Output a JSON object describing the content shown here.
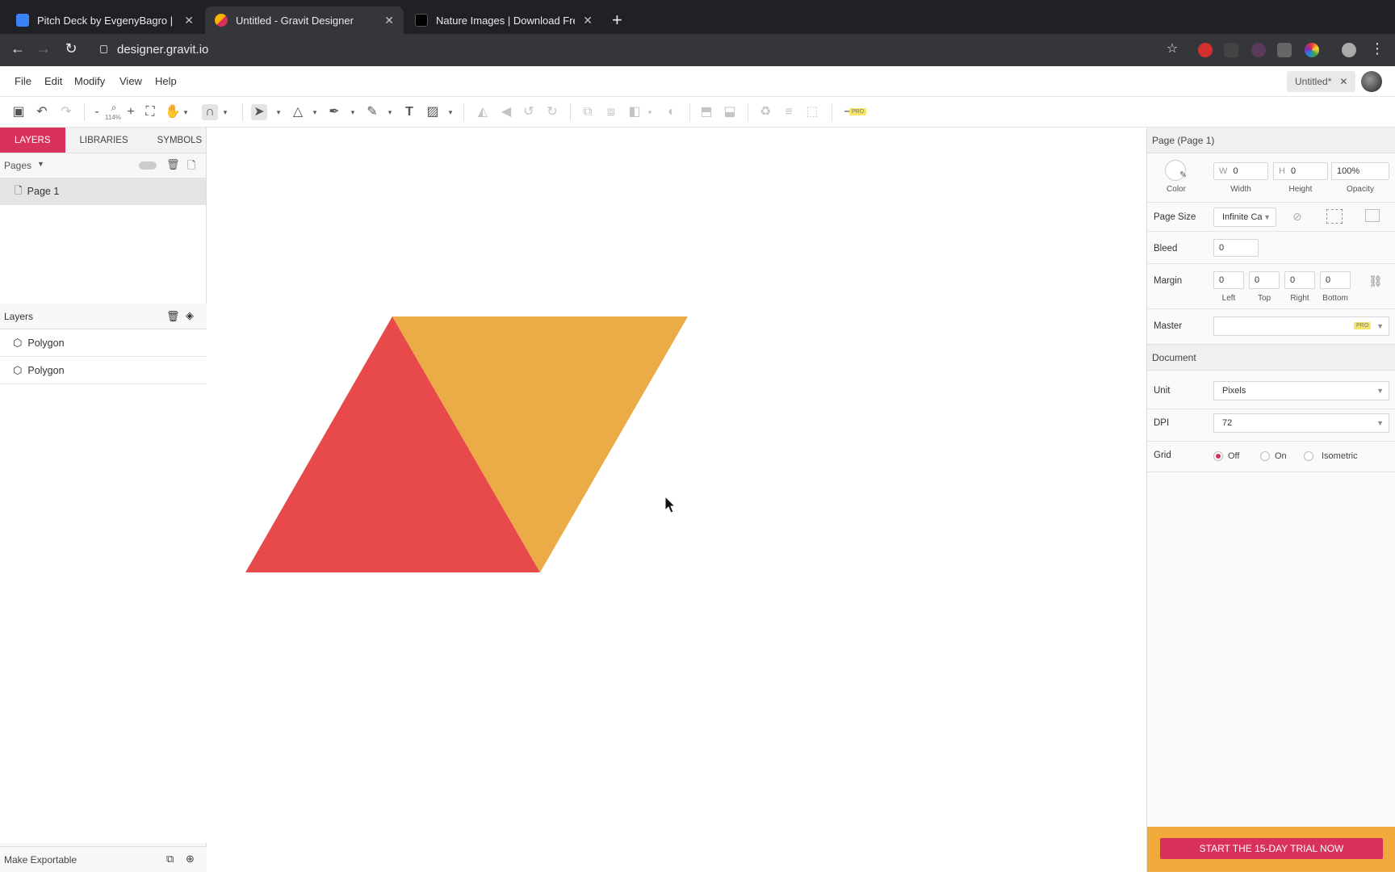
{
  "browser": {
    "tabs": [
      {
        "label": "Pitch Deck by EvgenyBagro | G",
        "active": false,
        "favicon_color": "#3b82f6"
      },
      {
        "label": "Untitled - Gravit Designer",
        "active": true,
        "favicon_color": "#f4b400"
      },
      {
        "label": "Nature Images | Download Free",
        "active": false,
        "favicon_color": "#000000"
      }
    ],
    "url": "designer.gravit.io"
  },
  "menu": {
    "items": [
      "File",
      "Edit",
      "Modify",
      "View",
      "Help"
    ],
    "doc_tab_label": "Untitled*",
    "zoom_label": "114%"
  },
  "left_panel": {
    "tabs": [
      "LAYERS",
      "LIBRARIES",
      "SYMBOLS"
    ],
    "pages_label": "Pages",
    "page_name": "Page 1",
    "layers_label": "Layers",
    "layers": [
      "Polygon",
      "Polygon"
    ],
    "bottom_label": "Make Exportable"
  },
  "right_panel": {
    "title": "Page (Page 1)",
    "width_prefix": "W",
    "width": "0",
    "height_prefix": "H",
    "height": "0",
    "opacity": "100%",
    "color_label": "Color",
    "width_label": "Width",
    "height_label": "Height",
    "opacity_label": "Opacity",
    "page_size_label": "Page Size",
    "page_size_value": "Infinite Ca",
    "bleed_label": "Bleed",
    "bleed_value": "0",
    "margin_label": "Margin",
    "margins": [
      {
        "value": "0",
        "label": "Left"
      },
      {
        "value": "0",
        "label": "Top"
      },
      {
        "value": "0",
        "label": "Right"
      },
      {
        "value": "0",
        "label": "Bottom"
      }
    ],
    "master_label": "Master",
    "pro_badge": "PRO",
    "document_label": "Document",
    "unit_label": "Unit",
    "unit_value": "Pixels",
    "dpi_label": "DPI",
    "dpi_value": "72",
    "grid_label": "Grid",
    "grid_options": [
      "Off",
      "On",
      "Isometric"
    ],
    "grid_selected": "Off",
    "trial_button": "START THE 15-DAY TRIAL NOW"
  },
  "canvas": {
    "shapes": [
      {
        "name": "red-triangle",
        "color": "#e84a4b"
      },
      {
        "name": "orange-triangle",
        "color": "#ebab46"
      }
    ]
  },
  "colors": {
    "accent": "#d8315b",
    "trial_bar": "#f2a93b"
  }
}
